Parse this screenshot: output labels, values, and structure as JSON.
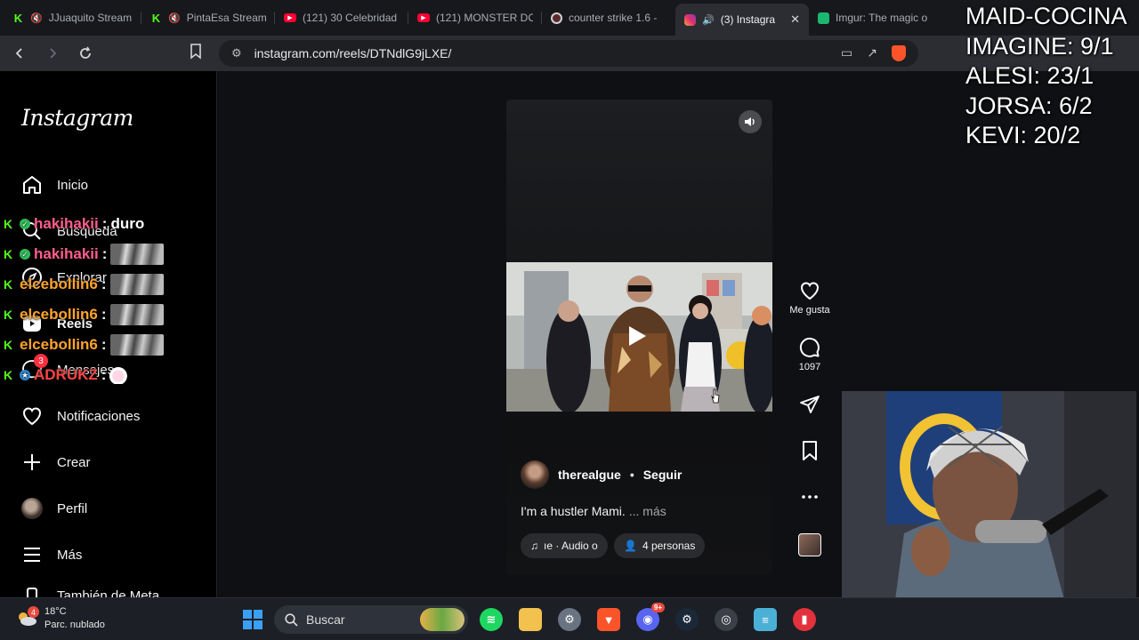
{
  "browser": {
    "tabs": [
      {
        "title": "JJuaquito Stream",
        "favicon": "kick-icon",
        "muted": true
      },
      {
        "title": "PintaEsa Stream",
        "favicon": "kick-icon",
        "muted": true
      },
      {
        "title": "(121) 30 Celebridad",
        "favicon": "youtube-icon",
        "muted": false
      },
      {
        "title": "(121) MONSTER DC",
        "favicon": "youtube-icon",
        "muted": false
      },
      {
        "title": "counter strike 1.6 -",
        "favicon": "game-icon",
        "muted": false
      },
      {
        "title": "(3) Instagra",
        "favicon": "instagram-icon",
        "muted": false,
        "playing_audio": true,
        "active": true
      },
      {
        "title": "Imgur: The magic o",
        "favicon": "imgur-icon",
        "muted": false
      }
    ],
    "url": "instagram.com/reels/DTNdlG9jLXE/"
  },
  "instagram": {
    "logo": "Instagram",
    "nav": {
      "home": "Inicio",
      "search": "Búsqueda",
      "explore": "Explorar",
      "reels": "Reels",
      "messages": "Mensajes",
      "messages_badge": "3",
      "notifications": "Notificaciones",
      "create": "Crear",
      "profile": "Perfil",
      "more": "Más",
      "partial_bottom": "También de Meta"
    },
    "reel": {
      "author": "therealgue",
      "follow": "Seguir",
      "caption": "I'm a hustler Mami.",
      "caption_more": "... más",
      "audio_pill": "ıe · Audio o",
      "people_pill": "4 personas",
      "sound_icon": "speaker-icon"
    },
    "actions": {
      "like_label": "Me gusta",
      "comments_count": "1097"
    }
  },
  "stream_overlay": {
    "chat": [
      {
        "user": "hakihakii",
        "message": "duro",
        "user_color": "#ff5e8a",
        "verified": true,
        "emote": false
      },
      {
        "user": "hakihakii",
        "message": "",
        "user_color": "#ff5e8a",
        "verified": true,
        "emote": true
      },
      {
        "user": "elcebollin6",
        "message": "",
        "user_color": "#ffa42b",
        "verified": false,
        "emote": true
      },
      {
        "user": "elcebollin6",
        "message": "",
        "user_color": "#ffa42b",
        "verified": false,
        "emote": true
      },
      {
        "user": "elcebollin6",
        "message": "",
        "user_color": "#ffa42b",
        "verified": false,
        "emote": true
      },
      {
        "user": "ADRUKZ",
        "message": "",
        "user_color": "#ff4545",
        "verified": false,
        "emote": true
      }
    ],
    "scoreboard": [
      "MAID-COCINA",
      "IMAGINE: 9/1",
      "ALESI: 23/1",
      "JORSA: 6/2",
      "KEVI: 20/2"
    ]
  },
  "taskbar": {
    "weather_temp": "18°C",
    "weather_desc": "Parc. nublado",
    "weather_badge": "4",
    "search_placeholder": "Buscar",
    "discord_badge": "9+"
  },
  "colors": {
    "kick_green": "#53fc18",
    "instagram_bg": "#000000",
    "accent_red": "#ff3040"
  }
}
